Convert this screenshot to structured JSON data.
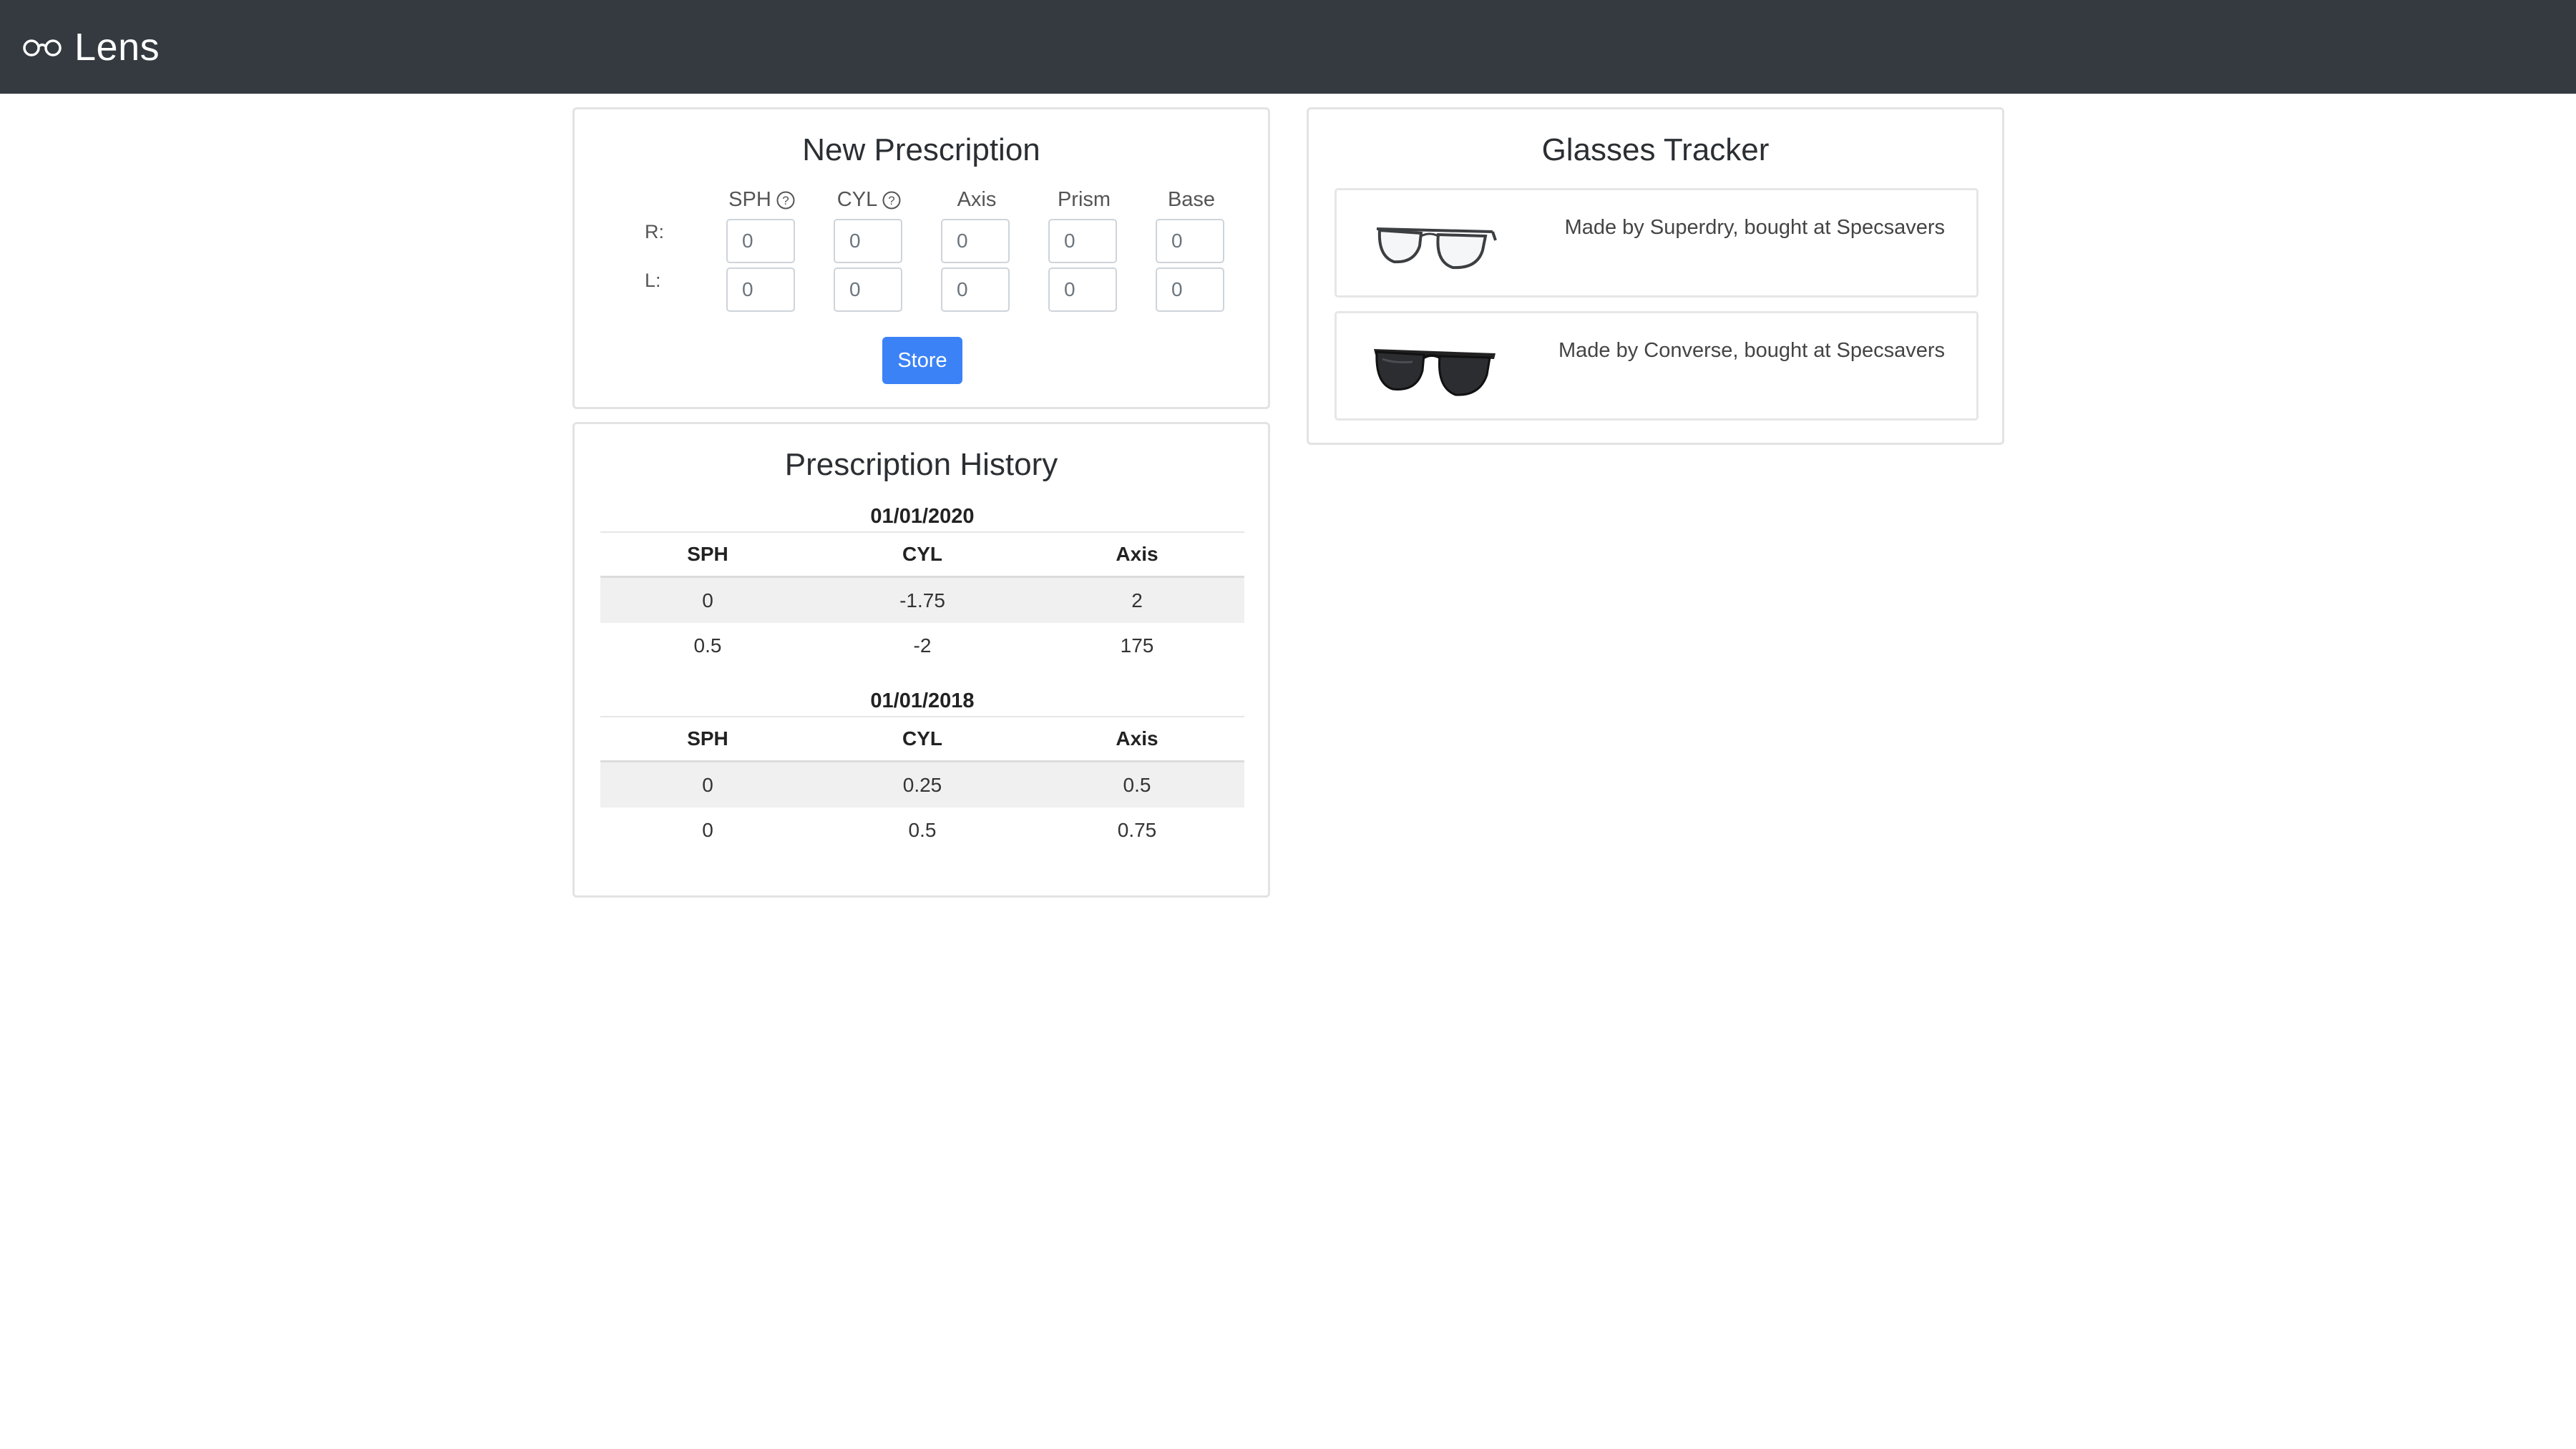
{
  "app": {
    "title": "Lens",
    "brand_icon": "glasses-icon"
  },
  "new_prescription": {
    "title": "New Prescription",
    "columns": [
      "SPH",
      "CYL",
      "Axis",
      "Prism",
      "Base"
    ],
    "help_columns": [
      "SPH",
      "CYL"
    ],
    "rows": [
      {
        "label": "R:",
        "values": [
          "0",
          "0",
          "0",
          "0",
          "0"
        ]
      },
      {
        "label": "L:",
        "values": [
          "0",
          "0",
          "0",
          "0",
          "0"
        ]
      }
    ],
    "store_label": "Store"
  },
  "history": {
    "title": "Prescription History",
    "entries": [
      {
        "date": "01/01/2020",
        "headers": [
          "SPH",
          "CYL",
          "Axis"
        ],
        "rows": [
          [
            "0",
            "-1.75",
            "2"
          ],
          [
            "0.5",
            "-2",
            "175"
          ]
        ]
      },
      {
        "date": "01/01/2018",
        "headers": [
          "SPH",
          "CYL",
          "Axis"
        ],
        "rows": [
          [
            "0",
            "0.25",
            "0.5"
          ],
          [
            "0",
            "0.5",
            "0.75"
          ]
        ]
      }
    ]
  },
  "glasses_tracker": {
    "title": "Glasses Tracker",
    "items": [
      {
        "description": "Made by Superdry, bought at Specsavers",
        "image": "clear-frame-glasses"
      },
      {
        "description": "Made by Converse, bought at Specsavers",
        "image": "dark-sunglasses"
      }
    ]
  },
  "colors": {
    "navbar": "#343a40",
    "primary": "#3b82f6"
  }
}
